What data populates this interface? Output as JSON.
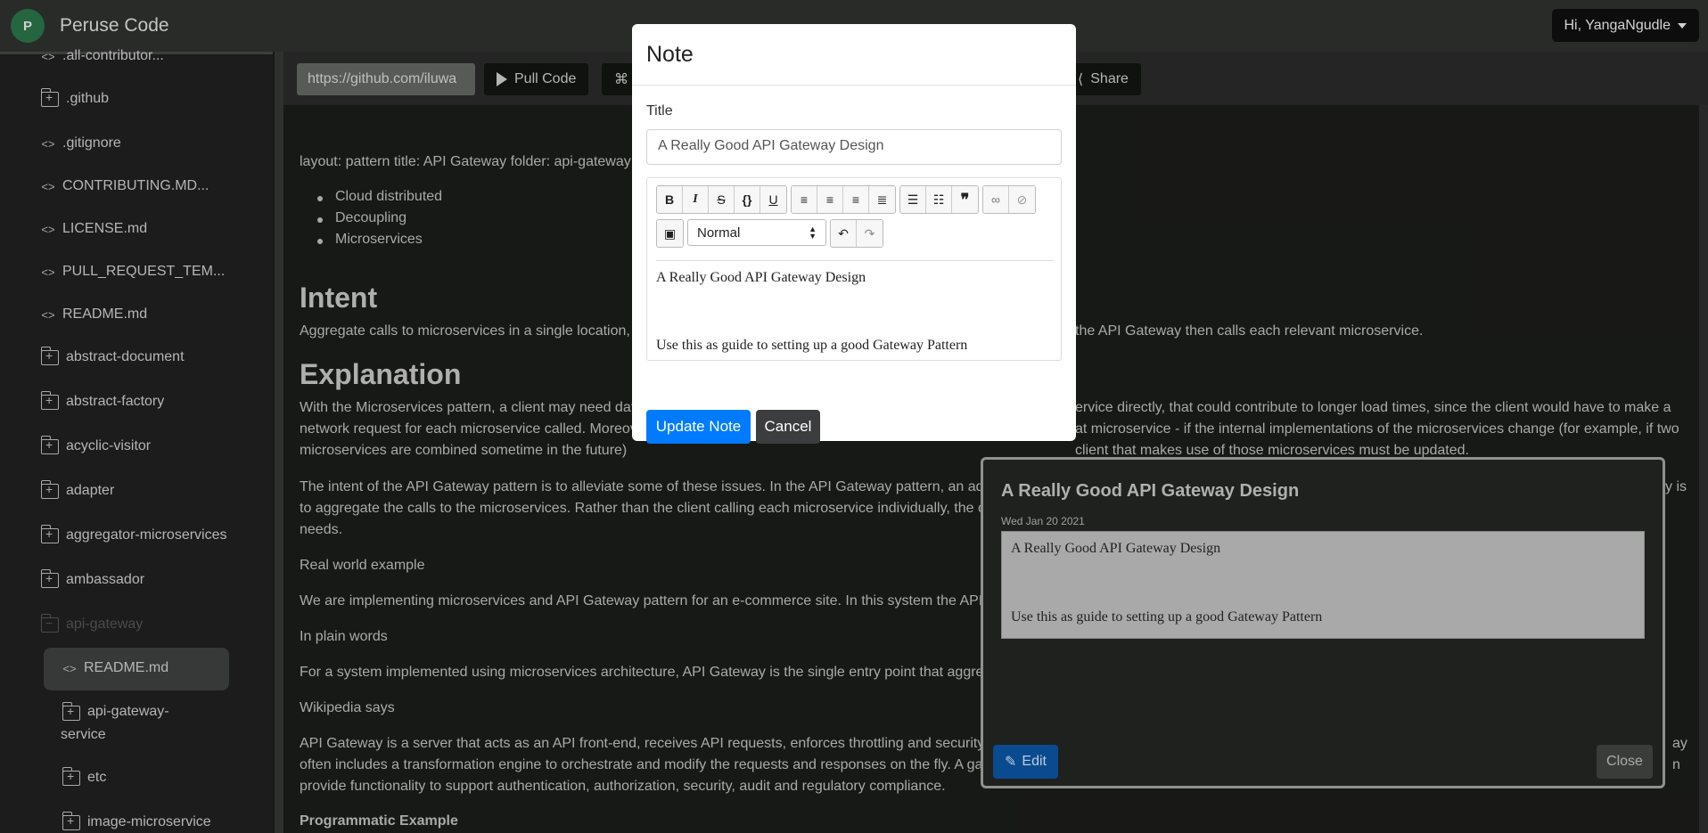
{
  "app": {
    "logo_letter": "P",
    "name": "Peruse Code",
    "user_menu": "Hi, YangaNgudle"
  },
  "sidebar": {
    "items": [
      {
        "label": ".all-contributor...",
        "kind": "file"
      },
      {
        "label": ".github",
        "kind": "folder"
      },
      {
        "label": ".gitignore",
        "kind": "file"
      },
      {
        "label": "CONTRIBUTING.MD...",
        "kind": "file"
      },
      {
        "label": "LICENSE.md",
        "kind": "file"
      },
      {
        "label": "PULL_REQUEST_TEM...",
        "kind": "file"
      },
      {
        "label": "README.md",
        "kind": "file"
      },
      {
        "label": "abstract-document",
        "kind": "folder"
      },
      {
        "label": "abstract-factory",
        "kind": "folder"
      },
      {
        "label": "acyclic-visitor",
        "kind": "folder"
      },
      {
        "label": "adapter",
        "kind": "folder"
      },
      {
        "label": "aggregator-microservices",
        "kind": "folder"
      },
      {
        "label": "ambassador",
        "kind": "folder"
      },
      {
        "label": "api-gateway",
        "kind": "folder-open"
      },
      {
        "label": "README.md",
        "kind": "file-selected"
      },
      {
        "label": "api-gateway-",
        "label2": "service",
        "kind": "folder"
      },
      {
        "label": "etc",
        "kind": "folder"
      },
      {
        "label": "image-microservice",
        "kind": "folder"
      }
    ]
  },
  "toolbar": {
    "url": "https://github.com/iluwa",
    "pull_code": "Pull Code",
    "share": "Share"
  },
  "doc": {
    "frontmatter": "layout: pattern title: API Gateway folder: api-gateway",
    "tags": [
      "Cloud distributed",
      "Decoupling",
      "Microservices"
    ],
    "intent_heading": "Intent",
    "intent_text_a": "Aggregate calls to microservices in a single location, ",
    "intent_text_b": "the API Gateway then calls each relevant microservice.",
    "explanation_heading": "Explanation",
    "p1_a": "With the Microservices pattern, a client may need dat",
    "p1_b": "ervice directly, that could contribute to longer load times, since the client would have to make a",
    "p1_c": "network request for each microservice called. Moreov",
    "p1_d": "at microservice - if the internal implementations of the microservices change (for example, if two",
    "p1_e": "microservices are combined sometime in the future) ",
    "p1_f": "client that makes use of those microservices must be updated.",
    "p2_a": "The intent of the API Gateway pattern is to alleviate some of these issues. In the API Gateway pattern, an add",
    "p2_b": "y is",
    "p2_c": "to aggregate the calls to the microservices. Rather than the client calling each microservice individually, the c",
    "p2_d": "needs.",
    "rwe": "Real world example",
    "p3": "We are implementing microservices and API Gateway pattern for an e-commerce site. In this system the API G",
    "ipw": "In plain words",
    "p4": "For a system implemented using microservices architecture, API Gateway is the single entry point that aggreg",
    "wiki": "Wikipedia says",
    "p5_a": "API Gateway is a server that acts as an API front-end, receives API requests, enforces throttling and security p",
    "p5_b": "ay",
    "p5_c": "often includes a transformation engine to orchestrate and modify the requests and responses on the fly. A ga",
    "p5_d": "n",
    "p5_e": "provide functionality to support authentication, authorization, security, audit and regulatory compliance.",
    "prog": "Programmatic Example"
  },
  "modal": {
    "title": "Note",
    "title_label": "Title",
    "title_value": "A Really Good API Gateway Design",
    "format_select": "Normal",
    "body_line1": "A Really Good API Gateway Design",
    "body_line2": "Use this as guide to setting up a good Gateway Pattern",
    "update_button": "Update Note",
    "cancel_button": "Cancel"
  },
  "note_card": {
    "title": "A Really Good API Gateway Design",
    "date": "Wed Jan 20 2021",
    "line1": "A Really Good API Gateway Design",
    "line2": "Use this as guide to setting up a good Gateway Pattern",
    "edit_button": "Edit",
    "close_button": "Close"
  }
}
